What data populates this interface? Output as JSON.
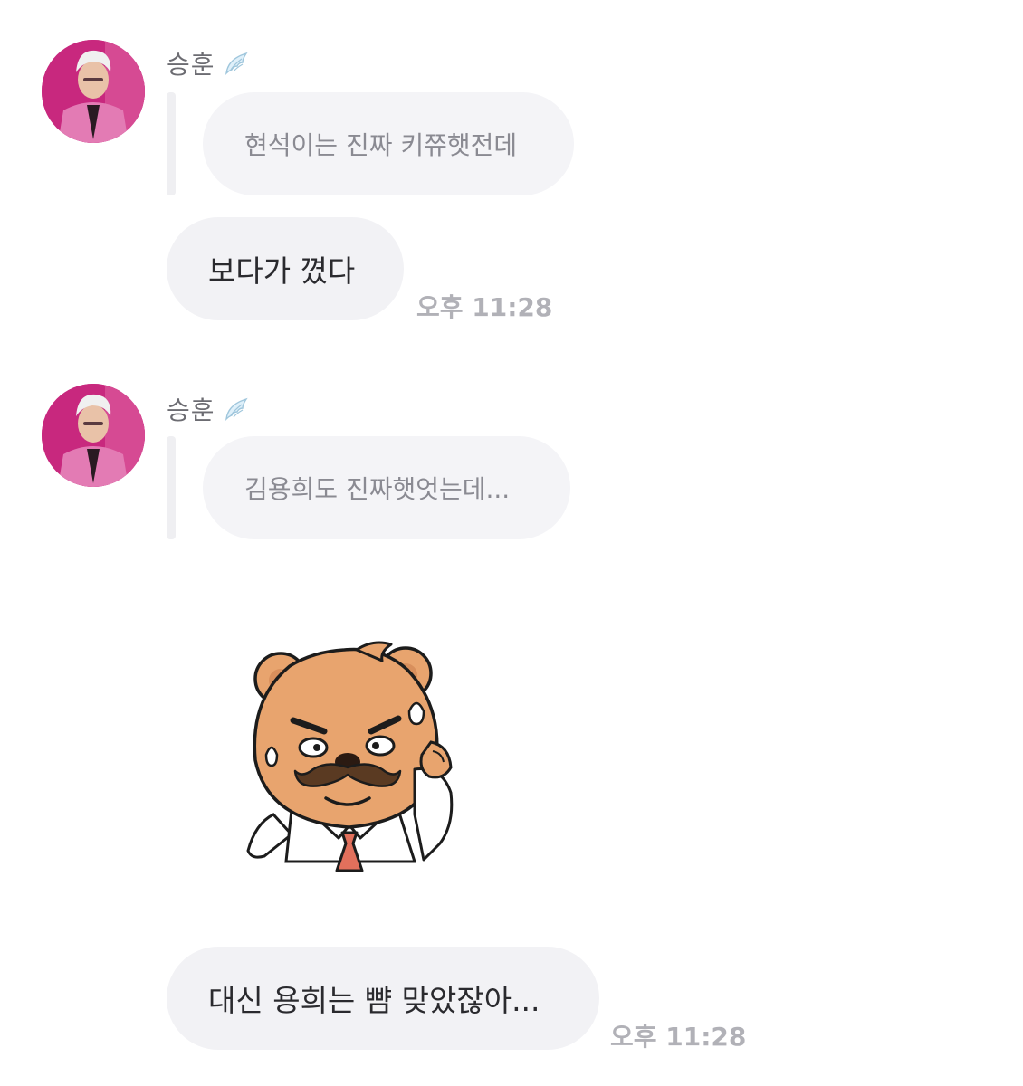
{
  "messages": [
    {
      "sender": "승훈",
      "reply_quote": "현석이는 진짜 키쮸햇전데",
      "text": "보다가 꼈다",
      "time": "오후 11:28"
    },
    {
      "sender": "승훈",
      "reply_quote": "김용희도 진짜햇엇는데...",
      "sticker": "mustache-bear-sticker",
      "text": "대신 용희는 뺨 맞았잖아...",
      "time": "오후 11:28"
    }
  ],
  "colors": {
    "avatar_bg": "#c8287e",
    "bubble_bg": "#f2f2f5",
    "time_text": "#b1b1b7",
    "bear_fill": "#e8a46e"
  },
  "icons": {
    "sender_badge": "wing-icon"
  }
}
